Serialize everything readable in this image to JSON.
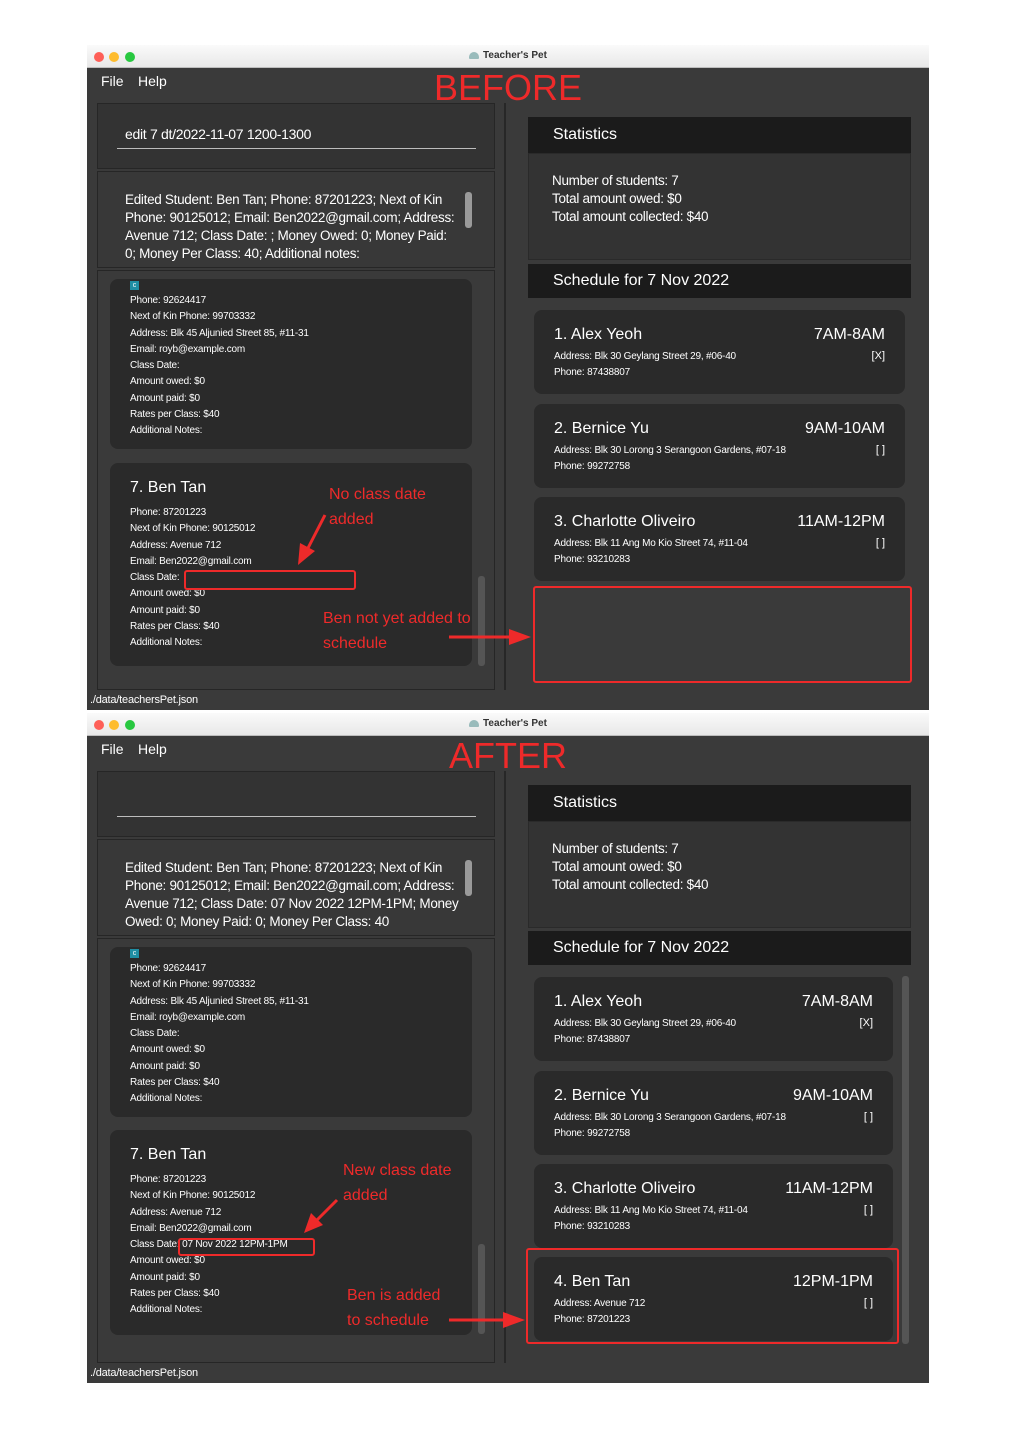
{
  "app_title": "Teacher's Pet",
  "menu": {
    "file": "File",
    "help": "Help"
  },
  "before": {
    "label": "BEFORE",
    "command_input": "edit 7 dt/2022-11-07 1200-1300",
    "result_text": "Edited Student: Ben Tan; Phone: 87201223; Next of Kin Phone: 90125012; Email: Ben2022@gmail.com; Address: Avenue 712; Class Date: ; Money Owed: 0; Money Paid: 0; Money Per Class: 40; Additional notes:",
    "card6": {
      "tag": "c",
      "phone": "Phone: 92624417",
      "nok": "Next of Kin Phone:  99703332",
      "address": "Address: Blk 45 Aljunied Street 85, #11-31",
      "email": "Email:  royb@example.com",
      "class_date": "Class Date:",
      "owed": "Amount owed: $0",
      "paid": "Amount paid: $0",
      "rate": "Rates per Class: $40",
      "notes": "Additional Notes:"
    },
    "card7": {
      "name": "7.  Ben Tan",
      "phone": "Phone: 87201223",
      "nok": "Next of Kin Phone:  90125012",
      "address": "Address:  Avenue 712",
      "email": "Email:  Ben2022@gmail.com",
      "class_date": "Class Date:",
      "owed": "Amount owed: $0",
      "paid": "Amount paid: $0",
      "rate": "Rates per Class: $40",
      "notes": "Additional Notes:"
    },
    "annotations": {
      "no_date": "No class date added",
      "not_added": "Ben not yet added to schedule"
    }
  },
  "after": {
    "label": "AFTER",
    "command_input": "",
    "result_text": "Edited Student: Ben Tan; Phone: 87201223; Next of Kin Phone: 90125012; Email: Ben2022@gmail.com; Address: Avenue 712; Class Date: 07 Nov 2022 12PM-1PM; Money Owed: 0; Money Paid: 0; Money Per Class: 40",
    "card6": {
      "tag": "c",
      "phone": "Phone: 92624417",
      "nok": "Next of Kin Phone:  99703332",
      "address": "Address: Blk 45 Aljunied Street 85, #11-31",
      "email": "Email:  royb@example.com",
      "class_date": "Class Date:",
      "owed": "Amount owed: $0",
      "paid": "Amount paid: $0",
      "rate": "Rates per Class: $40",
      "notes": "Additional Notes:"
    },
    "card7": {
      "name": "7.  Ben Tan",
      "phone": "Phone: 87201223",
      "nok": "Next of Kin Phone:  90125012",
      "address": "Address:  Avenue 712",
      "email": "Email:  Ben2022@gmail.com",
      "class_date": "Class Date:",
      "class_date_value": "07 Nov 2022 12PM-1PM",
      "owed": "Amount owed: $0",
      "paid": "Amount paid: $0",
      "rate": "Rates per Class: $40",
      "notes": "Additional Notes:"
    },
    "annotations": {
      "new_date": "New class date added",
      "added": "Ben is added to schedule"
    }
  },
  "statistics": {
    "title": "Statistics",
    "students": "Number of students: 7",
    "owed": "Total amount owed: $0",
    "collected": "Total amount collected: $40"
  },
  "schedule": {
    "title": "Schedule for 7 Nov 2022",
    "items": [
      {
        "name": "1.  Alex Yeoh",
        "time": "7AM-8AM",
        "address": "Address:  Blk 30 Geylang Street 29, #06-40",
        "phone": "Phone: 87438807",
        "mark": "[X]"
      },
      {
        "name": "2.  Bernice Yu",
        "time": "9AM-10AM",
        "address": "Address:  Blk 30 Lorong 3 Serangoon Gardens, #07-18",
        "phone": "Phone: 99272758",
        "mark": "[ ]"
      },
      {
        "name": "3.  Charlotte Oliveiro",
        "time": "11AM-12PM",
        "address": "Address:  Blk 11 Ang Mo Kio Street 74, #11-04",
        "phone": "Phone: 93210283",
        "mark": "[ ]"
      },
      {
        "name": "4.  Ben Tan",
        "time": "12PM-1PM",
        "address": "Address:  Avenue 712",
        "phone": "Phone: 87201223",
        "mark": "[ ]"
      }
    ]
  },
  "status_path": "./data/teachersPet.json"
}
